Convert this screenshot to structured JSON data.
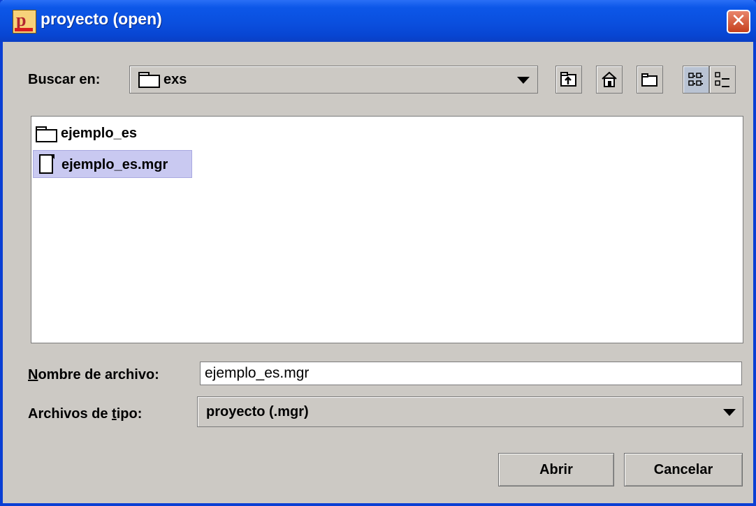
{
  "window": {
    "title": "proyecto (open)",
    "close_glyph": "✕",
    "accent_color": "#0a4fde"
  },
  "look_in": {
    "label": "Buscar en:",
    "value": "exs",
    "icon": "folder-icon"
  },
  "toolbar": {
    "buttons": [
      {
        "name": "up-one-level",
        "icon": "folder-up-icon"
      },
      {
        "name": "home",
        "icon": "home-icon"
      },
      {
        "name": "new-folder",
        "icon": "new-folder-icon"
      },
      {
        "name": "list-view",
        "icon": "list-view-icon",
        "active": true
      },
      {
        "name": "details-view",
        "icon": "details-view-icon",
        "active": false
      }
    ]
  },
  "files": [
    {
      "name": "ejemplo_es",
      "type": "folder",
      "selected": false
    },
    {
      "name": "ejemplo_es.mgr",
      "type": "file",
      "selected": true
    }
  ],
  "filename": {
    "label_prefix": "N",
    "label_rest": "ombre de archivo:",
    "value": "ejemplo_es.mgr"
  },
  "filetype": {
    "label_prefix": "Archivos de ",
    "label_underlined": "t",
    "label_rest": "ipo:",
    "value": "proyecto (.mgr)"
  },
  "actions": {
    "open_label": "Abrir",
    "cancel_label": "Cancelar"
  }
}
